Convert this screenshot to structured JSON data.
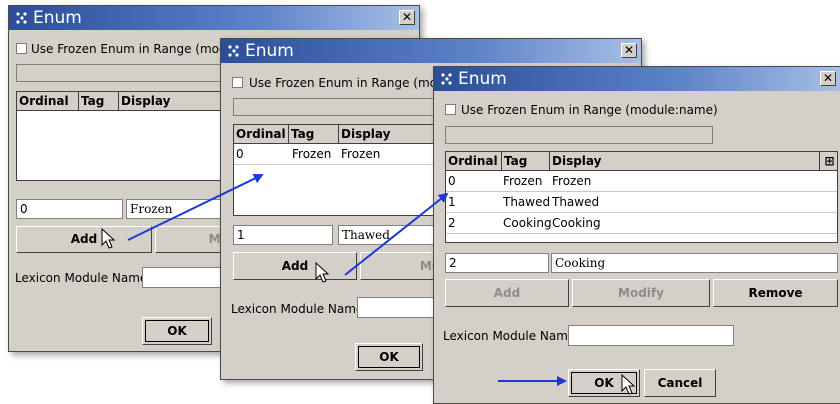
{
  "dialog1": {
    "title": "Enum",
    "checkbox_label": "Use Frozen Enum in Range (modu",
    "columns": [
      "Ordinal",
      "Tag",
      "Display"
    ],
    "rows": [],
    "ordinal_value": "0",
    "tag_value": "Frozen",
    "add_label": "Add",
    "modify_label": "Mod",
    "lexicon_label": "Lexicon Module Name",
    "ok_label": "OK"
  },
  "dialog2": {
    "title": "Enum",
    "checkbox_label": "Use Frozen Enum in Range (mod",
    "columns": [
      "Ordinal",
      "Tag",
      "Display"
    ],
    "rows": [
      {
        "ordinal": "0",
        "tag": "Frozen",
        "display": "Frozen"
      }
    ],
    "ordinal_value": "1",
    "tag_value": "Thawed",
    "add_label": "Add",
    "modify_label": "Mo",
    "lexicon_label": "Lexicon Module Name",
    "ok_label": "OK"
  },
  "dialog3": {
    "title": "Enum",
    "checkbox_label": "Use Frozen Enum in Range (module:name)",
    "columns": [
      "Ordinal",
      "Tag",
      "Display"
    ],
    "rows": [
      {
        "ordinal": "0",
        "tag": "Frozen",
        "display": "Frozen"
      },
      {
        "ordinal": "1",
        "tag": "Thawed",
        "display": "Thawed"
      },
      {
        "ordinal": "2",
        "tag": "Cooking",
        "display": "Cooking"
      }
    ],
    "ordinal_value": "2",
    "tag_value": "Cooking",
    "add_label": "Add",
    "modify_label": "Modify",
    "remove_label": "Remove",
    "lexicon_label": "Lexicon Module Name",
    "ok_label": "OK",
    "cancel_label": "Cancel"
  },
  "icons": {
    "title_icon": "enum-icon",
    "close": "close-icon",
    "column_chooser": "column-chooser-icon",
    "cursor": "mouse-pointer-icon"
  },
  "colors": {
    "titlebar": "#2c4e98",
    "dialog_bg": "#d4d0c8",
    "arrow": "#1a3ad8"
  }
}
